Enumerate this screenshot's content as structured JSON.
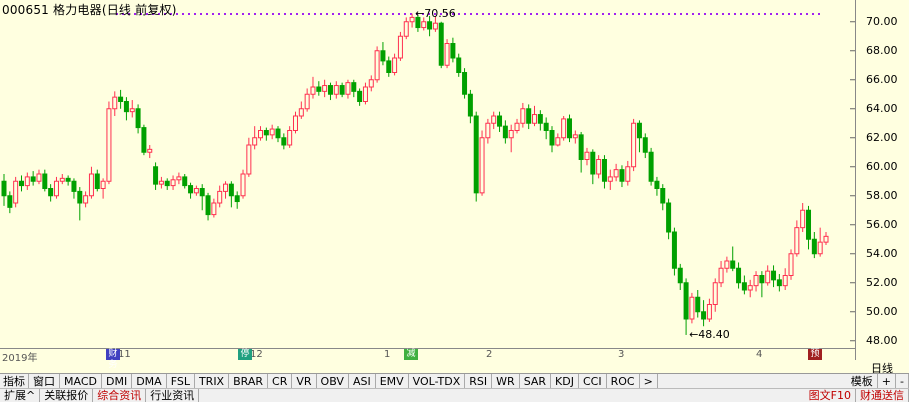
{
  "title": "000651 格力电器(日线 前复权)",
  "price_high": "70.56",
  "price_low": "48.40",
  "y_axis": {
    "labels": [
      "70.00",
      "68.00",
      "66.00",
      "64.00",
      "62.00",
      "60.00",
      "58.00",
      "56.00",
      "54.00",
      "52.00",
      "50.00",
      "48.00"
    ]
  },
  "x_axis": {
    "labels": [
      "2019年",
      "11",
      "12",
      "1",
      "2",
      "3",
      "4"
    ]
  },
  "markers": [
    {
      "text": "财务",
      "color": "#4040c0"
    },
    {
      "text": "停",
      "color": "#20a080"
    },
    {
      "text": "减",
      "color": "#40b040"
    },
    {
      "text": "预",
      "color": "#a02020"
    }
  ],
  "corner_label": "日线",
  "indicator_tabs": [
    "指标",
    "窗口",
    "MACD",
    "DMI",
    "DMA",
    "FSL",
    "TRIX",
    "BRAR",
    "CR",
    "VR",
    "OBV",
    "ASI",
    "EMV",
    "VOL-TDX",
    "RSI",
    "WR",
    "SAR",
    "KDJ",
    "CCI",
    "ROC",
    ">"
  ],
  "template_tab": "模板",
  "template_buttons": [
    "+",
    "-"
  ],
  "bottom_tabs": [
    {
      "label": "扩展^",
      "style": "normal"
    },
    {
      "label": "关联报价",
      "style": "normal"
    },
    {
      "label": "综合资讯",
      "style": "red"
    },
    {
      "label": "行业资讯",
      "style": "normal"
    }
  ],
  "bottom_right": [
    "图文F10",
    "财通送信"
  ],
  "colors": {
    "up": "#ff3050",
    "down": "#00a000",
    "bg": "#ffffe0",
    "dots": "#a020f0"
  },
  "chart_data": {
    "type": "candlestick",
    "ylim": [
      47.5,
      71.5
    ],
    "yticks": [
      70,
      68,
      66,
      64,
      62,
      60,
      58,
      56,
      54,
      52,
      50,
      48
    ],
    "candles": [
      [
        59.0,
        58.0,
        59.5,
        57.3
      ],
      [
        58.0,
        57.2,
        58.3,
        56.8
      ],
      [
        57.5,
        59.0,
        59.3,
        57.2
      ],
      [
        59.0,
        58.7,
        59.4,
        58.3
      ],
      [
        58.7,
        59.3,
        59.6,
        58.4
      ],
      [
        59.3,
        59.0,
        59.7,
        58.7
      ],
      [
        59.0,
        59.5,
        59.8,
        58.8
      ],
      [
        59.5,
        58.5,
        59.8,
        58.3
      ],
      [
        58.5,
        58.0,
        58.8,
        57.6
      ],
      [
        58.0,
        59.0,
        59.3,
        57.8
      ],
      [
        59.0,
        59.2,
        59.5,
        58.8
      ],
      [
        59.2,
        59.0,
        59.4,
        58.7
      ],
      [
        59.0,
        58.3,
        59.2,
        57.8
      ],
      [
        58.3,
        57.5,
        58.6,
        56.3
      ],
      [
        57.5,
        58.0,
        58.3,
        57.2
      ],
      [
        58.0,
        59.5,
        60.0,
        57.8
      ],
      [
        59.5,
        58.5,
        59.8,
        58.3
      ],
      [
        58.5,
        59.0,
        59.2,
        57.8
      ],
      [
        59.0,
        64.0,
        64.5,
        58.8
      ],
      [
        64.0,
        64.8,
        65.2,
        63.5
      ],
      [
        64.8,
        64.5,
        65.3,
        64.0
      ],
      [
        64.5,
        63.8,
        64.8,
        63.2
      ],
      [
        63.8,
        64.0,
        64.6,
        63.4
      ],
      [
        64.0,
        62.7,
        64.3,
        62.3
      ],
      [
        62.7,
        61.0,
        62.9,
        60.8
      ],
      [
        61.0,
        61.2,
        61.5,
        60.6
      ],
      [
        60.0,
        58.8,
        60.3,
        58.4
      ],
      [
        58.8,
        59.0,
        59.3,
        58.5
      ],
      [
        59.0,
        58.7,
        59.2,
        58.4
      ],
      [
        58.7,
        59.1,
        59.4,
        58.4
      ],
      [
        59.1,
        59.3,
        59.6,
        58.8
      ],
      [
        59.3,
        58.7,
        59.5,
        58.5
      ],
      [
        58.7,
        58.2,
        58.9,
        57.8
      ],
      [
        58.2,
        58.5,
        58.7,
        58.0
      ],
      [
        58.5,
        58.0,
        58.8,
        57.0
      ],
      [
        58.0,
        56.7,
        58.2,
        56.3
      ],
      [
        56.7,
        57.5,
        57.8,
        56.5
      ],
      [
        57.5,
        58.3,
        58.7,
        57.2
      ],
      [
        58.3,
        58.8,
        59.0,
        57.8
      ],
      [
        58.8,
        58.0,
        59.0,
        57.2
      ],
      [
        58.0,
        57.6,
        58.3,
        57.1
      ],
      [
        58.0,
        59.5,
        59.8,
        57.8
      ],
      [
        59.5,
        61.5,
        62.0,
        59.3
      ],
      [
        61.5,
        62.0,
        62.8,
        61.2
      ],
      [
        62.0,
        62.5,
        62.8,
        61.8
      ],
      [
        62.5,
        62.2,
        62.7,
        61.8
      ],
      [
        62.2,
        62.6,
        62.9,
        61.9
      ],
      [
        62.6,
        62.0,
        62.8,
        61.7
      ],
      [
        62.0,
        61.5,
        62.3,
        61.2
      ],
      [
        61.5,
        62.5,
        62.8,
        61.3
      ],
      [
        62.5,
        63.5,
        63.8,
        62.3
      ],
      [
        63.5,
        64.0,
        64.5,
        63.3
      ],
      [
        64.0,
        65.0,
        65.4,
        63.8
      ],
      [
        65.0,
        65.5,
        66.2,
        64.7
      ],
      [
        65.5,
        65.2,
        65.9,
        64.9
      ],
      [
        65.2,
        65.6,
        66.0,
        64.8
      ],
      [
        65.6,
        65.0,
        65.8,
        64.6
      ],
      [
        65.0,
        65.6,
        65.9,
        64.7
      ],
      [
        65.6,
        65.0,
        65.8,
        64.8
      ],
      [
        65.0,
        65.8,
        66.0,
        64.7
      ],
      [
        65.8,
        65.2,
        66.0,
        64.8
      ],
      [
        65.2,
        64.5,
        65.4,
        64.2
      ],
      [
        64.5,
        65.5,
        65.8,
        64.3
      ],
      [
        65.5,
        66.0,
        66.3,
        65.2
      ],
      [
        66.0,
        68.0,
        68.3,
        65.8
      ],
      [
        68.0,
        67.3,
        68.6,
        67.0
      ],
      [
        67.3,
        66.5,
        67.6,
        66.2
      ],
      [
        66.5,
        67.5,
        67.8,
        66.3
      ],
      [
        67.5,
        69.0,
        69.3,
        67.3
      ],
      [
        69.0,
        70.0,
        70.3,
        68.8
      ],
      [
        70.0,
        70.3,
        70.56,
        69.6
      ],
      [
        70.3,
        69.6,
        70.5,
        69.3
      ],
      [
        69.6,
        70.0,
        70.3,
        69.4
      ],
      [
        70.0,
        69.5,
        70.4,
        69.0
      ],
      [
        69.5,
        69.9,
        70.4,
        69.3
      ],
      [
        69.9,
        67.0,
        70.0,
        66.8
      ],
      [
        67.0,
        68.5,
        68.8,
        66.8
      ],
      [
        68.5,
        67.5,
        68.9,
        67.2
      ],
      [
        67.5,
        66.5,
        67.8,
        66.2
      ],
      [
        66.5,
        65.0,
        66.8,
        64.7
      ],
      [
        65.0,
        63.5,
        65.3,
        63.0
      ],
      [
        63.5,
        58.2,
        63.8,
        57.6
      ],
      [
        58.2,
        62.0,
        62.5,
        58.0
      ],
      [
        62.0,
        63.0,
        63.3,
        61.6
      ],
      [
        63.0,
        63.5,
        63.8,
        62.6
      ],
      [
        63.5,
        62.8,
        63.8,
        62.4
      ],
      [
        62.8,
        62.0,
        63.2,
        61.6
      ],
      [
        62.0,
        62.5,
        62.9,
        61.0
      ],
      [
        62.5,
        63.0,
        63.3,
        62.3
      ],
      [
        63.0,
        64.0,
        64.4,
        62.7
      ],
      [
        64.0,
        63.0,
        64.3,
        62.6
      ],
      [
        63.0,
        63.6,
        64.2,
        62.8
      ],
      [
        63.6,
        63.0,
        63.9,
        62.5
      ],
      [
        63.0,
        62.5,
        63.4,
        61.9
      ],
      [
        62.5,
        61.5,
        62.8,
        61.0
      ],
      [
        61.5,
        62.0,
        62.3,
        61.4
      ],
      [
        62.0,
        63.3,
        63.5,
        61.8
      ],
      [
        63.3,
        62.0,
        63.6,
        61.7
      ],
      [
        62.0,
        62.2,
        62.5,
        61.6
      ],
      [
        62.2,
        60.5,
        62.4,
        59.6
      ],
      [
        60.5,
        61.0,
        61.3,
        60.1
      ],
      [
        61.0,
        59.5,
        61.2,
        58.8
      ],
      [
        59.5,
        60.5,
        60.8,
        59.2
      ],
      [
        60.5,
        59.0,
        60.8,
        58.5
      ],
      [
        59.0,
        59.3,
        59.8,
        58.4
      ],
      [
        59.3,
        59.8,
        60.2,
        59.0
      ],
      [
        59.8,
        59.0,
        60.1,
        58.6
      ],
      [
        59.0,
        60.0,
        60.4,
        58.7
      ],
      [
        60.0,
        63.0,
        63.3,
        59.7
      ],
      [
        63.0,
        62.0,
        63.2,
        61.0
      ],
      [
        62.0,
        61.0,
        62.3,
        60.6
      ],
      [
        61.0,
        59.0,
        61.3,
        58.7
      ],
      [
        59.0,
        58.5,
        59.3,
        58.0
      ],
      [
        58.5,
        57.5,
        58.8,
        57.0
      ],
      [
        57.5,
        55.5,
        57.8,
        55.0
      ],
      [
        55.5,
        53.0,
        55.8,
        52.5
      ],
      [
        53.0,
        52.0,
        53.3,
        51.5
      ],
      [
        52.0,
        49.5,
        52.3,
        48.4
      ],
      [
        49.5,
        51.0,
        51.3,
        49.2
      ],
      [
        51.0,
        50.0,
        51.5,
        49.6
      ],
      [
        50.0,
        49.5,
        50.8,
        49.0
      ],
      [
        49.5,
        50.5,
        50.9,
        49.3
      ],
      [
        50.5,
        52.0,
        52.3,
        50.0
      ],
      [
        52.0,
        53.0,
        53.5,
        51.7
      ],
      [
        53.0,
        53.5,
        53.8,
        52.7
      ],
      [
        53.5,
        53.0,
        54.5,
        52.8
      ],
      [
        53.0,
        52.0,
        53.4,
        51.6
      ],
      [
        52.0,
        51.5,
        52.5,
        51.2
      ],
      [
        51.5,
        51.8,
        52.2,
        51.0
      ],
      [
        51.8,
        52.5,
        52.8,
        51.4
      ],
      [
        52.5,
        52.0,
        52.8,
        51.0
      ],
      [
        52.0,
        52.8,
        53.2,
        51.8
      ],
      [
        52.8,
        52.2,
        53.2,
        51.7
      ],
      [
        52.2,
        51.8,
        52.6,
        51.4
      ],
      [
        51.8,
        52.5,
        53.0,
        51.5
      ],
      [
        52.5,
        54.0,
        54.3,
        52.2
      ],
      [
        54.0,
        55.8,
        56.3,
        53.8
      ],
      [
        55.8,
        57.0,
        57.5,
        55.5
      ],
      [
        57.0,
        55.0,
        57.3,
        54.3
      ],
      [
        55.0,
        54.0,
        55.5,
        53.7
      ],
      [
        54.0,
        54.8,
        55.8,
        53.8
      ],
      [
        54.8,
        55.2,
        55.5,
        54.6
      ]
    ]
  }
}
